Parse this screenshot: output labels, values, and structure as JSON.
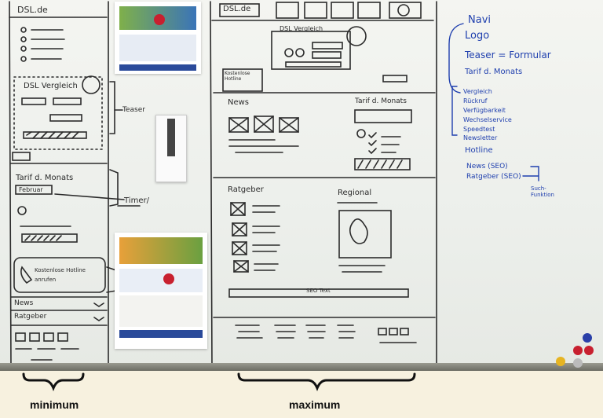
{
  "captions": {
    "minimum": "minimum",
    "maximum": "maximum"
  },
  "mobile": {
    "logo": "DSL.de",
    "comparison_title": "DSL Vergleich",
    "teaser_label": "Teaser",
    "tariff_title": "Tarif d. Monats",
    "tariff_month": "Februar",
    "timer_label": "Timer/",
    "info_text": "Kostenlose Hotline anrufen",
    "accordion": [
      "News",
      "Ratgeber"
    ]
  },
  "desktop": {
    "logo": "DSL.de",
    "comparison_title": "DSL Vergleich",
    "hotline_note": "Kostenlose Hotline",
    "news_title": "News",
    "tariff_title": "Tarif d. Monats",
    "advisor_title": "Ratgeber",
    "regional_title": "Regional",
    "seo_text": "SEO Text"
  },
  "notes": {
    "items": [
      "Navi",
      "Logo",
      "Teaser = Formular",
      "Tarif d. Monats"
    ],
    "sub_items": [
      "Vergleich",
      "Rückruf",
      "Verfügbarkeit",
      "Wechselservice",
      "Speedtest",
      "Newsletter"
    ],
    "hotline": "Hotline",
    "seo_items": [
      "News (SEO)",
      "Ratgeber (SEO)"
    ],
    "search": "Such-Funktion"
  },
  "colors": {
    "ink": "#2b2b2b",
    "blue_ink": "#1f3fae",
    "magnet_red": "#c8202f",
    "board": "#f1f3ef"
  }
}
